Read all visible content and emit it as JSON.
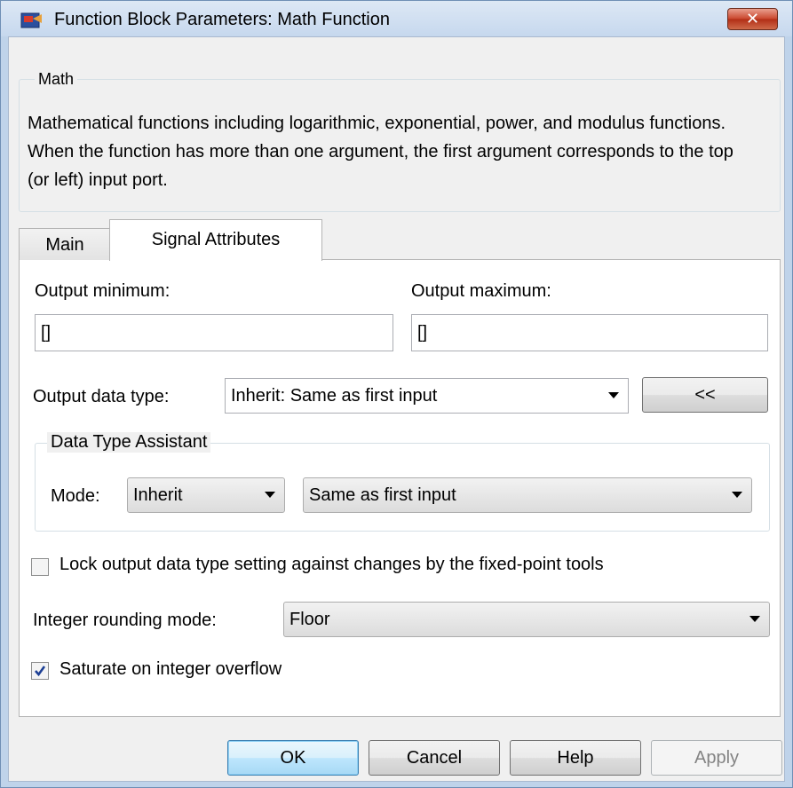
{
  "window": {
    "title": "Function Block Parameters: Math Function",
    "close_label": "✕"
  },
  "math_group": {
    "title": "Math",
    "description": "Mathematical functions including logarithmic, exponential, power, and modulus functions.  When the function has more than one argument, the first argument corresponds to the top (or left) input port."
  },
  "tabs": [
    {
      "label": "Main",
      "active": false
    },
    {
      "label": "Signal Attributes",
      "active": true
    }
  ],
  "signal_attributes": {
    "output_min_label": "Output minimum:",
    "output_min_value": "[]",
    "output_max_label": "Output maximum:",
    "output_max_value": "[]",
    "output_data_type_label": "Output data type:",
    "output_data_type_value": "Inherit: Same as first input",
    "assistant_toggle_label": "<<",
    "assistant": {
      "title": "Data Type Assistant",
      "mode_label": "Mode:",
      "mode_value": "Inherit",
      "inherit_rule_value": "Same as first input"
    },
    "lock_checkbox": {
      "label": "Lock output data type setting against changes by the fixed-point tools",
      "checked": false
    },
    "rounding_label": "Integer rounding mode:",
    "rounding_value": "Floor",
    "saturate_checkbox": {
      "label": "Saturate on integer overflow",
      "checked": true
    }
  },
  "buttons": {
    "ok": "OK",
    "cancel": "Cancel",
    "help": "Help",
    "apply": "Apply"
  },
  "colors": {
    "check_mark": "#1c3f94",
    "title_bar": "#c6d8ee",
    "close_button": "#c9452c"
  }
}
